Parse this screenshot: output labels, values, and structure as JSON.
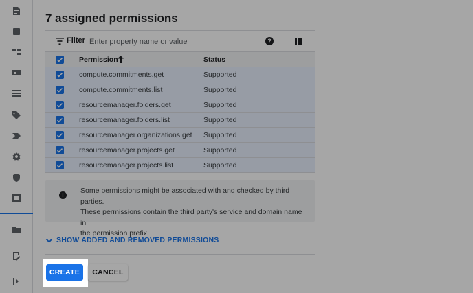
{
  "page": {
    "title": "7 assigned permissions"
  },
  "rail": {
    "icons": [
      "document-icon",
      "note-icon",
      "tree-icon",
      "card-icon",
      "list-icon",
      "tag-icon",
      "label-icon",
      "gear-icon",
      "shield-icon",
      "grid-icon",
      "folder-gear-icon",
      "doc-edit-icon",
      "expand-rail-icon"
    ]
  },
  "toolbar": {
    "filter_label": "Filter",
    "filter_placeholder": "Enter property name or value",
    "help_glyph": "?"
  },
  "table": {
    "headers": {
      "permission": "Permission",
      "status": "Status"
    },
    "rows": [
      {
        "permission": "compute.commitments.get",
        "status": "Supported"
      },
      {
        "permission": "compute.commitments.list",
        "status": "Supported"
      },
      {
        "permission": "resourcemanager.folders.get",
        "status": "Supported"
      },
      {
        "permission": "resourcemanager.folders.list",
        "status": "Supported"
      },
      {
        "permission": "resourcemanager.organizations.get",
        "status": "Supported"
      },
      {
        "permission": "resourcemanager.projects.get",
        "status": "Supported"
      },
      {
        "permission": "resourcemanager.projects.list",
        "status": "Supported"
      }
    ]
  },
  "info": {
    "glyph": "i",
    "line1": "Some permissions might be associated with and checked by third parties.",
    "line2": "These permissions contain the third party's service and domain name in",
    "line3": "the permission prefix."
  },
  "show_link": {
    "label": "SHOW ADDED AND REMOVED PERMISSIONS"
  },
  "actions": {
    "create_label": "CREATE",
    "cancel_label": "CANCEL"
  },
  "colors": {
    "accent": "#1a73e8",
    "row_selected": "#e8f0fe",
    "header_bg": "#f1f3f4",
    "overlay": "rgba(0,0,0,0.35)"
  }
}
